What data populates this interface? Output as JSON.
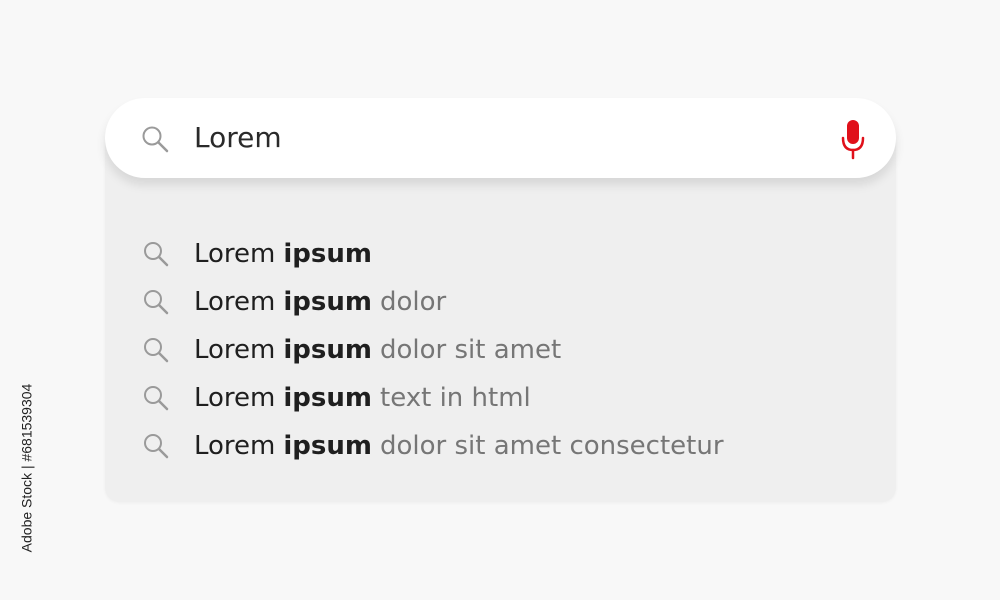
{
  "search": {
    "query": "Lorem",
    "icon": "search-icon",
    "mic_icon": "microphone-icon",
    "mic_color": "#e0101a"
  },
  "suggestions": [
    {
      "typed": "Lorem",
      "bold": "ipsum",
      "rest": ""
    },
    {
      "typed": "Lorem",
      "bold": "ipsum",
      "rest": "dolor"
    },
    {
      "typed": "Lorem",
      "bold": "ipsum",
      "rest": "dolor sit amet"
    },
    {
      "typed": "Lorem",
      "bold": "ipsum",
      "rest": "text in html"
    },
    {
      "typed": "Lorem",
      "bold": "ipsum",
      "rest": "dolor sit amet consectetur"
    }
  ],
  "watermark": {
    "side_text": "Adobe Stock | #681539304"
  },
  "colors": {
    "background": "#f8f8f8",
    "dropdown": "#efefef",
    "bar": "#ffffff",
    "text_primary": "#1f1f1f",
    "text_secondary": "#767676",
    "icon_gray": "#9a9a9a"
  }
}
